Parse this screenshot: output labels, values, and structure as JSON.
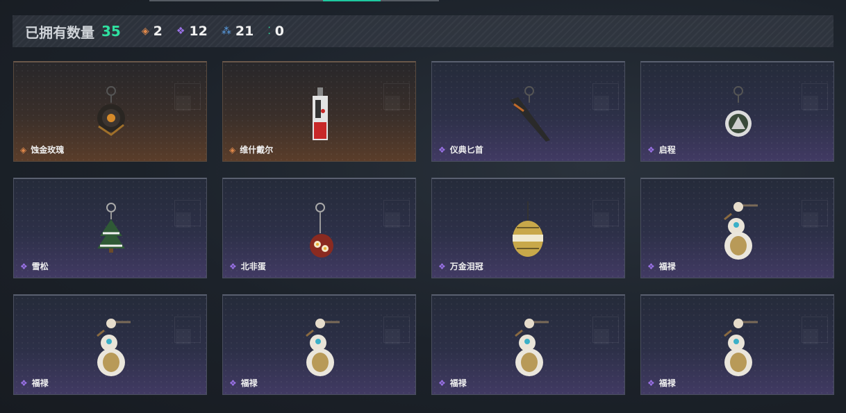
{
  "summary": {
    "label": "已拥有数量",
    "total": "35",
    "rarities": [
      {
        "icon": "orange-diamond-icon",
        "glyph": "◈",
        "color": "#e0884a",
        "count": "2"
      },
      {
        "icon": "purple-diamond-icon",
        "glyph": "❖",
        "color": "#9b72e8",
        "count": "12"
      },
      {
        "icon": "blue-triangle-icon",
        "glyph": "⁂",
        "color": "#5aa0e8",
        "count": "21"
      },
      {
        "icon": "green-dots-icon",
        "glyph": "⁚",
        "color": "#2fe0a0",
        "count": "0"
      }
    ]
  },
  "items": [
    {
      "name": "蚀金玫瑰",
      "rarity": "orange",
      "rarity_color": "#e0884a",
      "art": "rose"
    },
    {
      "name": "维什戴尔",
      "rarity": "orange",
      "rarity_color": "#e0884a",
      "art": "tag"
    },
    {
      "name": "仪典匕首",
      "rarity": "purple",
      "rarity_color": "#9b72e8",
      "art": "dagger"
    },
    {
      "name": "启程",
      "rarity": "purple",
      "rarity_color": "#9b72e8",
      "art": "medal"
    },
    {
      "name": "雪松",
      "rarity": "purple",
      "rarity_color": "#9b72e8",
      "art": "tree"
    },
    {
      "name": "北非蛋",
      "rarity": "purple",
      "rarity_color": "#9b72e8",
      "art": "pan"
    },
    {
      "name": "万金泪冠",
      "rarity": "purple",
      "rarity_color": "#9b72e8",
      "art": "egg"
    },
    {
      "name": "福禄",
      "rarity": "purple",
      "rarity_color": "#9b72e8",
      "art": "gourd"
    },
    {
      "name": "福禄",
      "rarity": "purple",
      "rarity_color": "#9b72e8",
      "art": "gourd"
    },
    {
      "name": "福禄",
      "rarity": "purple",
      "rarity_color": "#9b72e8",
      "art": "gourd"
    },
    {
      "name": "福禄",
      "rarity": "purple",
      "rarity_color": "#9b72e8",
      "art": "gourd"
    },
    {
      "name": "福禄",
      "rarity": "purple",
      "rarity_color": "#9b72e8",
      "art": "gourd"
    }
  ]
}
